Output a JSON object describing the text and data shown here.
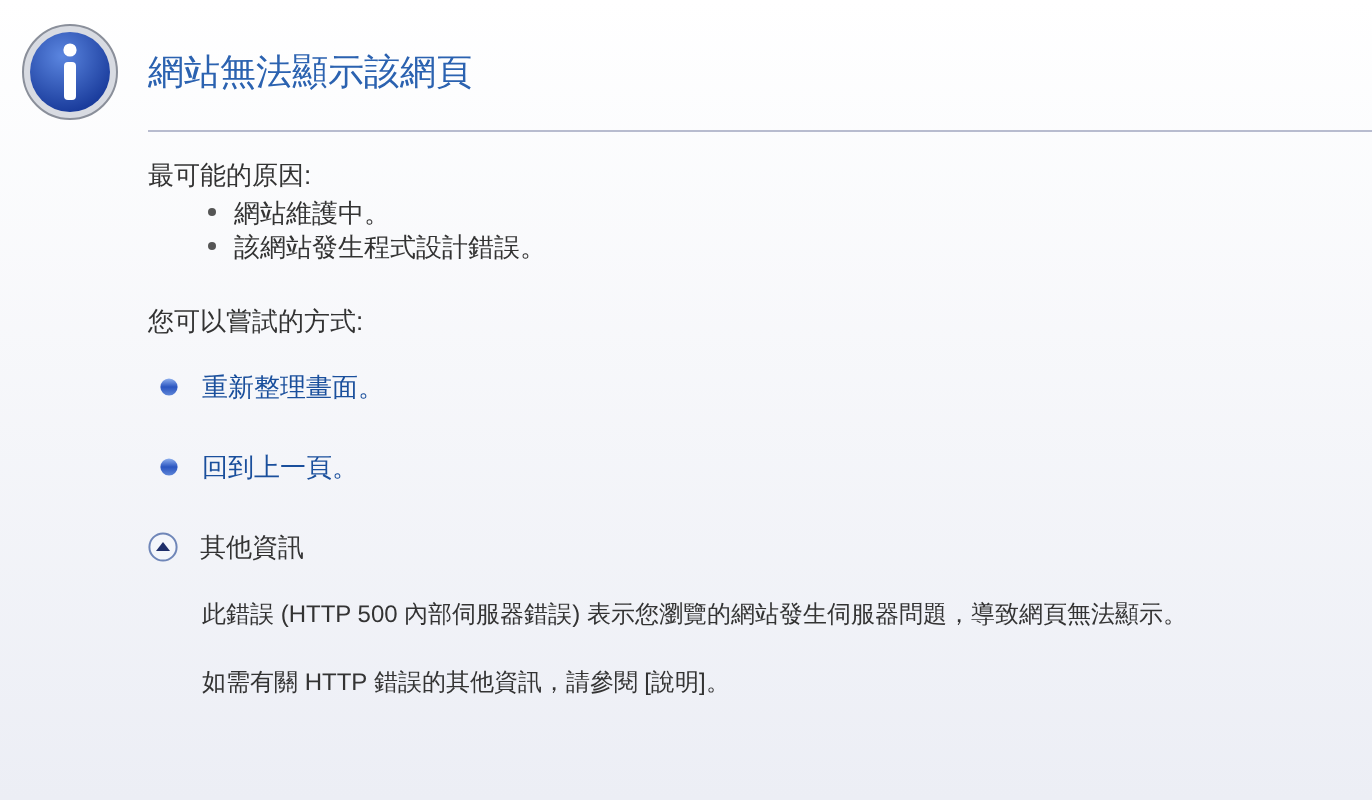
{
  "title": "網站無法顯示該網頁",
  "causes": {
    "heading": "最可能的原因:",
    "items": [
      "網站維護中。",
      "該網站發生程式設計錯誤。"
    ]
  },
  "actions": {
    "heading": "您可以嘗試的方式:",
    "items": [
      "重新整理畫面。",
      "回到上一頁。"
    ]
  },
  "more_info": {
    "label": "其他資訊",
    "expanded": true,
    "paragraphs": [
      "此錯誤 (HTTP 500 內部伺服器錯誤) 表示您瀏覽的網站發生伺服器問題，導致網頁無法顯示。",
      "如需有關 HTTP 錯誤的其他資訊，請參閱 [說明]。"
    ]
  }
}
